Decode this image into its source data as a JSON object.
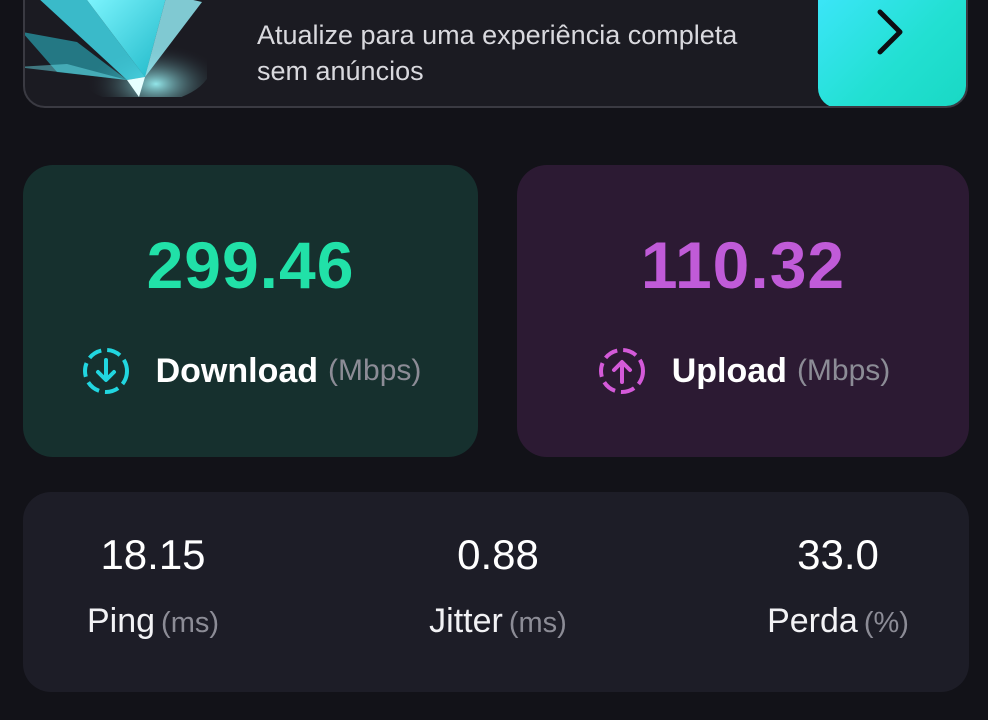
{
  "promo": {
    "subtitle_line1": "Atualize para uma experiência completa",
    "subtitle_line2": "sem anúncios",
    "button_icon": "chevron-right-icon",
    "accent_color": "#2ee3d6"
  },
  "download": {
    "value": "299.46",
    "label": "Download",
    "unit": "(Mbps)",
    "icon": "download-arrow-icon",
    "color": "#21e1a8"
  },
  "upload": {
    "value": "110.32",
    "label": "Upload",
    "unit": "(Mbps)",
    "icon": "upload-arrow-icon",
    "color": "#c05bd8"
  },
  "stats": {
    "ping": {
      "value": "18.15",
      "label": "Ping",
      "unit": "(ms)"
    },
    "jitter": {
      "value": "0.88",
      "label": "Jitter",
      "unit": "(ms)"
    },
    "perda": {
      "value": "33.0",
      "label": "Perda",
      "unit": "(%)"
    }
  }
}
